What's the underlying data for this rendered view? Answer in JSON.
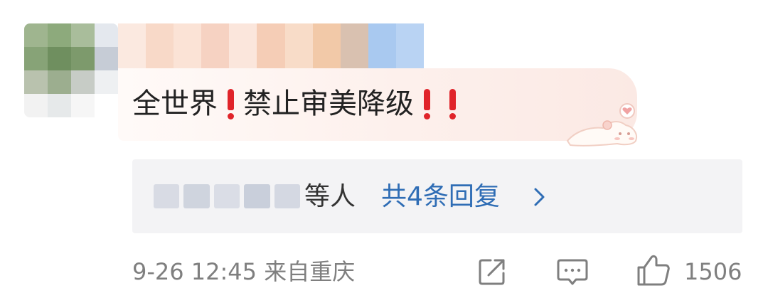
{
  "comment": {
    "parts": [
      "全世界",
      "禁止审美降级"
    ]
  },
  "replies": {
    "names_suffix": "等人",
    "count_label": "共4条回复"
  },
  "meta": {
    "timestamp": "9-26 12:45",
    "location": "来自重庆"
  },
  "actions": {
    "like_count": "1506"
  },
  "icons": {
    "exclamation": "exclamation-icon",
    "chevron": "chevron-right-icon",
    "share": "share-icon",
    "comment": "comment-icon",
    "like": "thumbs-up-icon"
  },
  "colors": {
    "link": "#2f6db5",
    "exclamation": "#e0242a",
    "meta_text": "#7f7f7f",
    "reply_bg": "#f3f3f5"
  }
}
